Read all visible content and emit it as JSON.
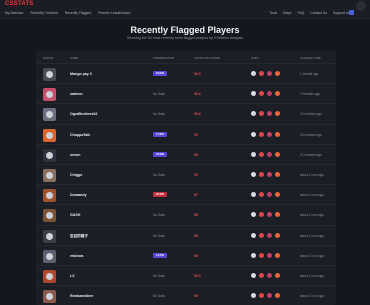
{
  "topbar": {
    "logo": "CSSTATS",
    "nav": [
      "My Matches",
      "Recently Checked",
      "Recently Flagged",
      "Premier Leaderboard"
    ],
    "right_nav": [
      "Tools",
      "Maps",
      "FAQ",
      "Contact Us",
      "Support Us"
    ]
  },
  "header": {
    "title": "Recently Flagged Players",
    "subtitle": "Showing the 30 most recently seen flagged players by CSWatch Analysis"
  },
  "table": {
    "columns": [
      "Avatar",
      "Name",
      "Premier Rank",
      "Suspicion Score",
      "Links",
      "Flagged Time"
    ],
    "rows": [
      {
        "name": "Mango pay 3",
        "rank_label": "18,940",
        "rank_color": "#5b44d9",
        "score": "98.5",
        "score_color": "#e04848",
        "time": "1 minute ago",
        "avatar_color": "#4a4d58"
      },
      {
        "name": "salmon",
        "rank_label": "No Data",
        "rank_color": "",
        "score": "96.6",
        "score_color": "#e04848",
        "time": "7 minutes ago",
        "avatar_color": "#c94f6b"
      },
      {
        "name": "OgraBrothers02",
        "rank_label": "No Data",
        "rank_color": "",
        "score": "96.6",
        "score_color": "#e04848",
        "time": "10 minutes ago",
        "avatar_color": "#6a7080"
      },
      {
        "name": "ChuppaTalk",
        "rank_label": "17,819",
        "rank_color": "#5b44d9",
        "score": "89",
        "score_color": "#e04848",
        "time": "16 minutes ago",
        "avatar_color": "#d9652e"
      },
      {
        "name": "seeon",
        "rank_label": "18,999",
        "rank_color": "#5b44d9",
        "score": "86",
        "score_color": "#e04848",
        "time": "21 minutes ago",
        "avatar_color": "#2f3340"
      },
      {
        "name": "Chiggo",
        "rank_label": "No Data",
        "rank_color": "",
        "score": "89",
        "score_color": "#e04848",
        "time": "about 1 hour ago",
        "avatar_color": "#8a6e5e"
      },
      {
        "name": "Duraandy",
        "rank_label": "26,900",
        "rank_color": "#c2303b",
        "score": "87",
        "score_color": "#e04848",
        "time": "about 1 hour ago",
        "avatar_color": "#a0522d"
      },
      {
        "name": "GASH",
        "rank_label": "No Data",
        "rank_color": "",
        "score": "86",
        "score_color": "#e04848",
        "time": "about 1 hour ago",
        "avatar_color": "#7a5236"
      },
      {
        "name": "忍忍的猫子",
        "rank_label": "No Data",
        "rank_color": "",
        "score": "86",
        "score_color": "#e04848",
        "time": "about 1 hour ago",
        "avatar_color": "#3c3f48"
      },
      {
        "name": "reklows",
        "rank_label": "14,550",
        "rank_color": "#5b44d9",
        "score": "86",
        "score_color": "#e04848",
        "time": "about 1 hour ago",
        "avatar_color": "#5d6070"
      },
      {
        "name": "LX",
        "rank_label": "No Data",
        "rank_color": "",
        "score": "98.5",
        "score_color": "#e04848",
        "time": "about 1 hour ago",
        "avatar_color": "#b2472f"
      },
      {
        "name": "Realsamidere",
        "rank_label": "No Data",
        "rank_color": "",
        "score": "89",
        "score_color": "#e04848",
        "time": "about 1 hour ago",
        "avatar_color": "#8a5a4a"
      }
    ]
  },
  "links_colors": [
    "#d9dbe0",
    "#e04848",
    "#c43d63",
    "#e8663a"
  ]
}
